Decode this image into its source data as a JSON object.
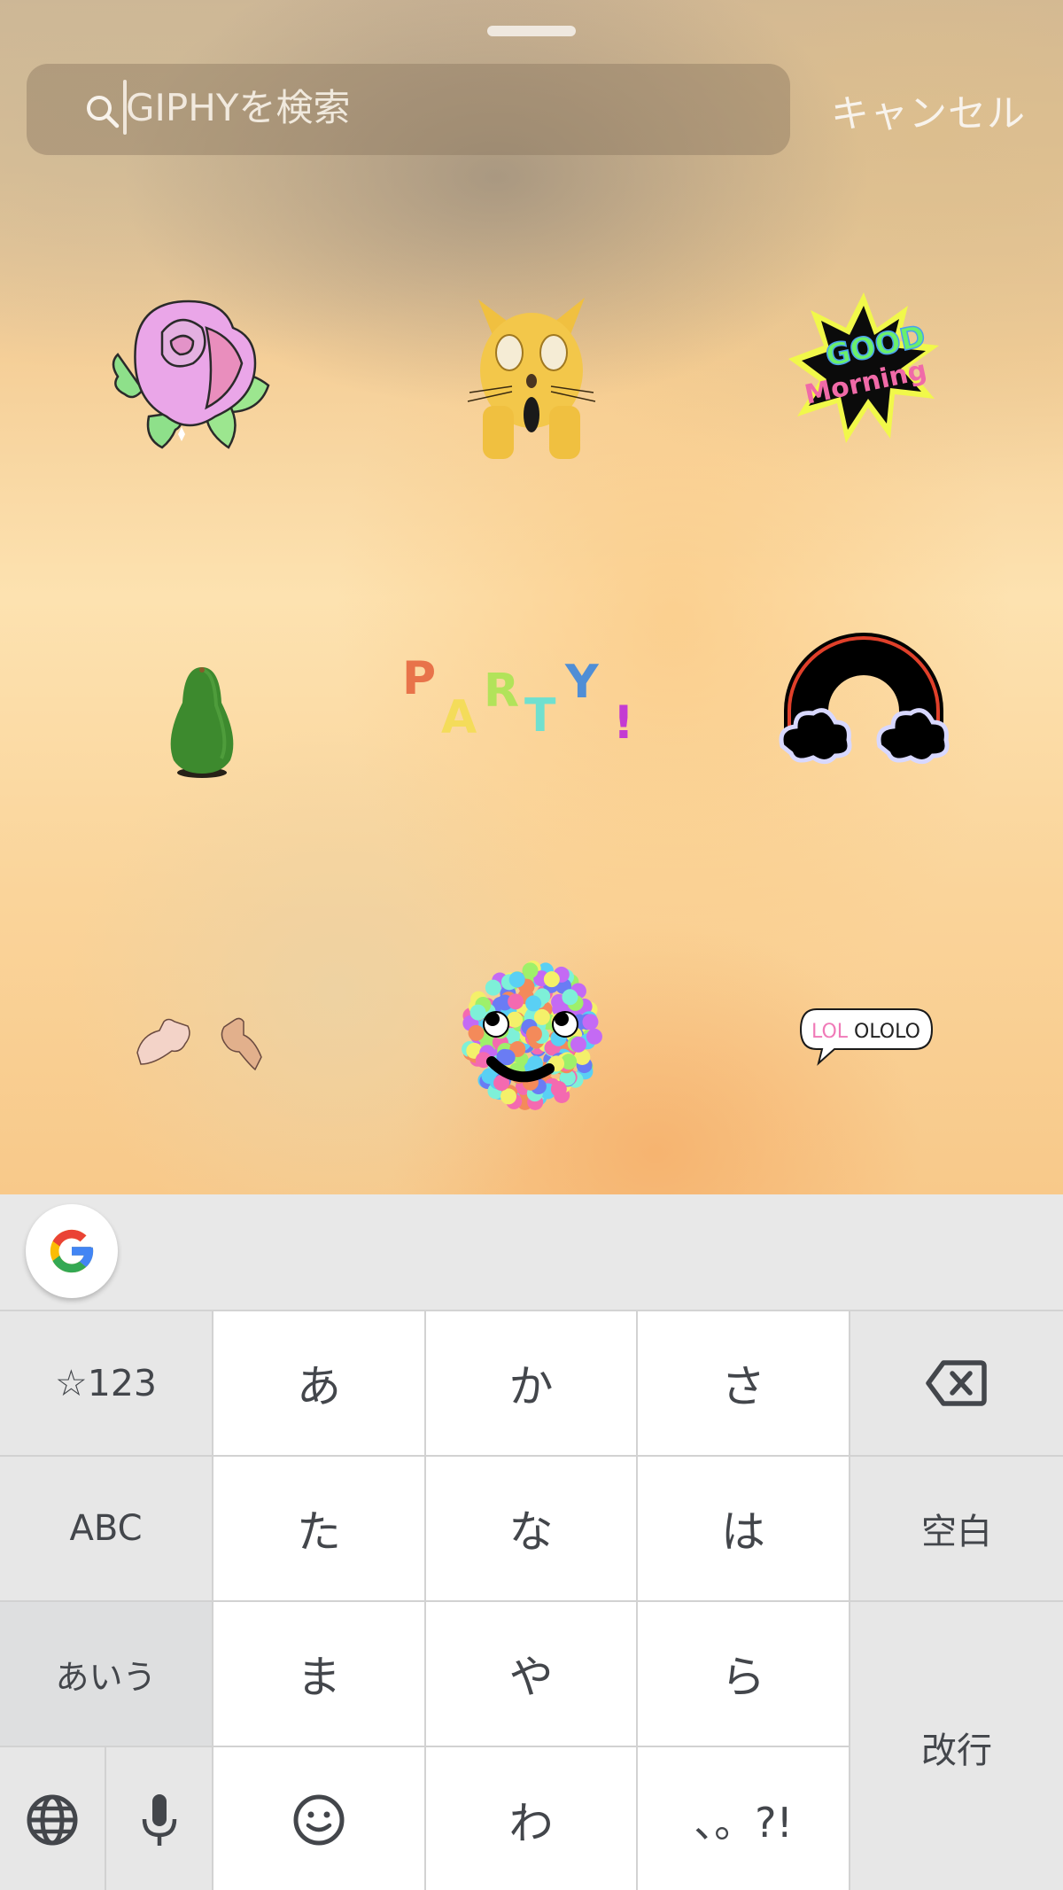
{
  "search": {
    "placeholder": "GIPHYを検索",
    "value": "",
    "search_icon": "search-icon",
    "cancel_label": "キャンセル"
  },
  "grabber": "drag-handle",
  "stickers": [
    {
      "name": "pink-rose",
      "description": "Pink rose with green leaves"
    },
    {
      "name": "shocked-cat",
      "description": "Yellow cat covering mouth in shock"
    },
    {
      "name": "good-morning",
      "description": "Good Morning starburst",
      "text_line1": "GOOD",
      "text_line2": "Morning"
    },
    {
      "name": "avocado",
      "description": "Whole green avocado"
    },
    {
      "name": "party",
      "description": "Colorful PARTY! letters",
      "letters": [
        "P",
        "A",
        "R",
        "T",
        "Y",
        "!"
      ],
      "colors": [
        "#e8734a",
        "#f4dc5a",
        "#b2e35a",
        "#6fe0cf",
        "#4f8ed6",
        "#c43bd2"
      ]
    },
    {
      "name": "neon-rainbow",
      "description": "Neon rainbow with clouds"
    },
    {
      "name": "pinky-promise-hands",
      "description": "Two hands making pinky promise"
    },
    {
      "name": "rainbow-smiley-ball",
      "description": "Smiling ball of colorful dots"
    },
    {
      "name": "lol-speech-bubble",
      "description": "Speech bubble saying LOLOLOLO",
      "text_pink": "LOL",
      "text_black": "OLOLO"
    }
  ],
  "keyboard": {
    "suggest": {
      "google_button": "google-g-icon"
    },
    "rows": [
      [
        {
          "label": "☆123",
          "name": "key-symbols-123",
          "style": "gray"
        },
        {
          "label": "あ",
          "name": "key-a",
          "style": "white"
        },
        {
          "label": "か",
          "name": "key-ka",
          "style": "white"
        },
        {
          "label": "さ",
          "name": "key-sa",
          "style": "white"
        },
        {
          "label": "",
          "icon": "backspace-icon",
          "name": "key-backspace",
          "style": "gray"
        }
      ],
      [
        {
          "label": "ABC",
          "name": "key-abc",
          "style": "gray"
        },
        {
          "label": "た",
          "name": "key-ta",
          "style": "white"
        },
        {
          "label": "な",
          "name": "key-na",
          "style": "white"
        },
        {
          "label": "は",
          "name": "key-ha",
          "style": "white"
        },
        {
          "label": "空白",
          "name": "key-space",
          "style": "gray"
        }
      ],
      [
        {
          "label": "あいう",
          "name": "key-kana-mode",
          "style": "gray-dark"
        },
        {
          "label": "ま",
          "name": "key-ma",
          "style": "white"
        },
        {
          "label": "や",
          "name": "key-ya",
          "style": "white"
        },
        {
          "label": "ら",
          "name": "key-ra",
          "style": "white"
        },
        {
          "label": "改行",
          "name": "key-enter",
          "style": "gray"
        }
      ],
      [
        {
          "label": "",
          "icon": "globe-icon",
          "name": "key-language",
          "style": "gray"
        },
        {
          "label": "",
          "icon": "microphone-icon",
          "name": "key-voice",
          "style": "gray"
        },
        {
          "label": "",
          "icon": "emoji-icon",
          "name": "key-emoji",
          "style": "white"
        },
        {
          "label": "わ",
          "name": "key-wa",
          "style": "white"
        },
        {
          "label": "、。?!",
          "name": "key-punctuation",
          "style": "white"
        }
      ]
    ]
  },
  "colors": {
    "key_white": "#ffffff",
    "key_gray": "#e7e7e7",
    "key_text": "#43464b",
    "google_blue": "#4285f4",
    "google_red": "#ea4335",
    "google_yellow": "#fbbc05",
    "google_green": "#34a853"
  }
}
